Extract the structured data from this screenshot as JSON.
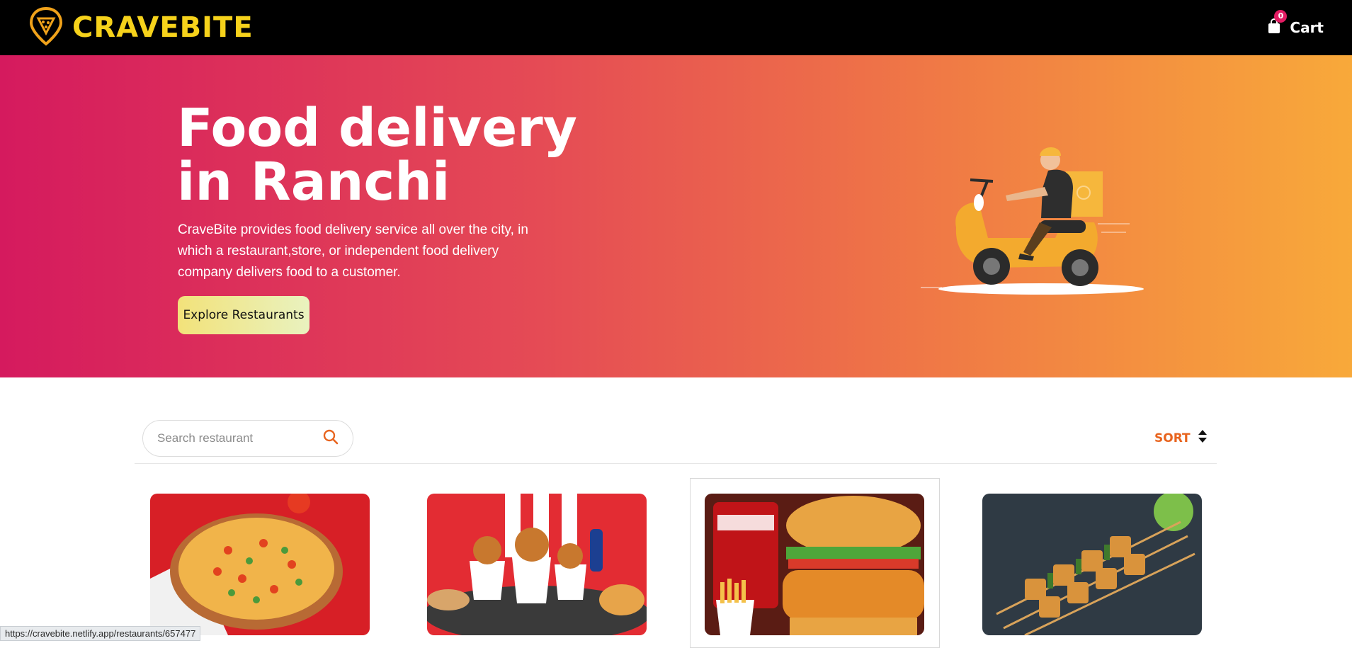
{
  "header": {
    "brand": "CRAVEBITE",
    "logo_icon": "pizza-location-pin-icon",
    "cart_label": "Cart",
    "cart_count": "0",
    "cart_icon": "shopping-bag-icon"
  },
  "hero": {
    "title_line1": "Food delivery",
    "title_line2": "in Ranchi",
    "description": "CraveBite provides food delivery service all over the city, in which a restaurant,store, or independent food delivery company delivers food to a customer.",
    "cta": "Explore Restaurants",
    "illustration": "delivery-scooter-illustration"
  },
  "search": {
    "placeholder": "Search restaurant",
    "value": ""
  },
  "sort": {
    "label": "SORT"
  },
  "restaurants": [
    {
      "image": "pizza-image"
    },
    {
      "image": "kfc-bucket-image"
    },
    {
      "image": "burger-king-image"
    },
    {
      "image": "paneer-tikka-image"
    }
  ],
  "status_bar": {
    "url": "https://cravebite.netlify.app/restaurants/657477"
  },
  "colors": {
    "brand_yellow": "#f6d21b",
    "hero_start": "#d51a5e",
    "hero_end": "#f8a93a",
    "sort_orange": "#e8641e",
    "badge": "#e31c63"
  }
}
